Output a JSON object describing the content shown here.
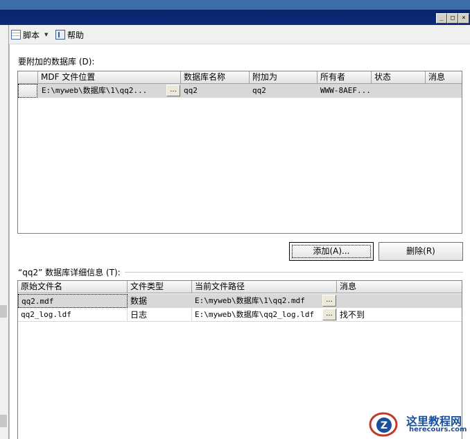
{
  "window": {
    "minimize_glyph": "_",
    "maximize_glyph": "□",
    "close_glyph": "×"
  },
  "toolbar": {
    "script_label": "脚本",
    "help_label": "帮助"
  },
  "attach_section": {
    "label": "要附加的数据库 (D):",
    "columns": [
      "MDF 文件位置",
      "数据库名称",
      "附加为",
      "所有者",
      "状态",
      "消息"
    ],
    "rows": [
      {
        "mdf_path": "E:\\myweb\\数据库\\1\\qq2...",
        "db_name": "qq2",
        "attach_as": "qq2",
        "owner": "WWW-8AEF...",
        "status": "",
        "message": ""
      }
    ],
    "browse_label": "..."
  },
  "buttons": {
    "add_label": "添加(A)...",
    "remove_label": "删除(R)"
  },
  "details_section": {
    "label": "“qq2” 数据库详细信息 (T):",
    "columns": [
      "原始文件名",
      "文件类型",
      "当前文件路径",
      "消息"
    ],
    "rows": [
      {
        "original_name": "qq2.mdf",
        "file_type": "数据",
        "current_path": "E:\\myweb\\数据库\\1\\qq2.mdf",
        "message": ""
      },
      {
        "original_name": "qq2_log.ldf",
        "file_type": "日志",
        "current_path": "E:\\myweb\\数据库\\qq2_log.ldf",
        "message": "找不到"
      }
    ],
    "browse_label": "..."
  },
  "watermark": {
    "brand_cn": "这里教程网",
    "brand_url": "herecours.com"
  },
  "colors": {
    "titlebar": "#0a246a",
    "selected_row": "#d8d8d8",
    "brand": "#1a4f9c"
  }
}
